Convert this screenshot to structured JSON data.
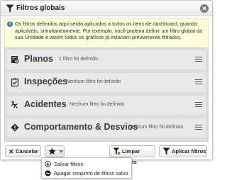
{
  "dialog": {
    "title": "Filtros globais",
    "info_text": "Os filtros definidos aqui serão aplicados a todos os itens de dashboard, quando aplicáveis, simultaneamente. Por exemplo, você poderia definir um filtro global da sua Unidade e assim todos os gráficos já estariam previamente filtrados."
  },
  "filters": [
    {
      "label": "Planos",
      "status": "1 filtro foi definido",
      "icon": "planos-icon"
    },
    {
      "label": "Inspeções",
      "status": "Nenhum filtro foi definido",
      "icon": "clipboard-check-icon"
    },
    {
      "label": "Acidentes",
      "status": "Nenhum filtro foi definido",
      "icon": "falling-person-icon"
    },
    {
      "label": "Comportamento & Desvios",
      "status": "Nenhum filtro foi definido",
      "icon": "warning-diamond-icon"
    }
  ],
  "footer": {
    "cancel_label": "Cancelar",
    "clear_label": "Limpar filtros",
    "apply_label": "Aplicar filtros"
  },
  "dropdown": {
    "items": [
      {
        "label": "Salvar filtros",
        "icon": "save-cloud-icon"
      },
      {
        "label": "Apagar conjunto de filtros salvo",
        "icon": "delete-circle-icon"
      }
    ]
  },
  "colors": {
    "info_bg": "#fdfbd9",
    "panel_bg": "#dcdcdc",
    "row_bg": "#e8e8e8",
    "info_icon": "#2a7fc4",
    "clear_icon_red": "#d23a2a"
  }
}
